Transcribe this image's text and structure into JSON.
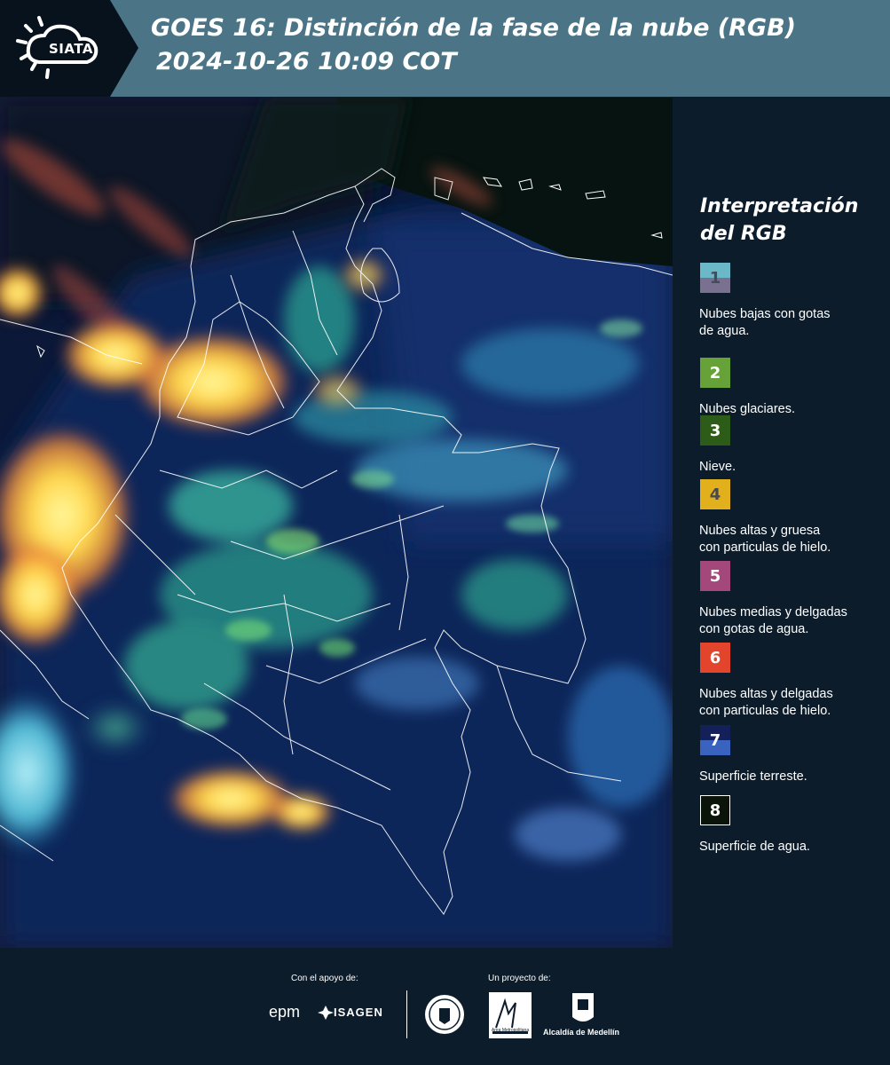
{
  "header": {
    "logo_text": "SIATA",
    "title_line1": "GOES 16: Distinción de la fase de la nube (RGB)",
    "title_line2": "2024-10-26 10:09 COT",
    "background_color": "#4b7586"
  },
  "legend": {
    "title_line1": "Interpretación",
    "title_line2": "del RGB",
    "items": [
      {
        "number": "1",
        "label_line1": "Nubes bajas con gotas",
        "label_line2": "de agua.",
        "color_top": "#6bb8c8",
        "color_bottom": "#7a7090",
        "text_color": "#454b5c"
      },
      {
        "number": "2",
        "label_line1": "Nubes glaciares.",
        "label_line2": "",
        "color_top": "#66a237",
        "color_bottom": "#66a237",
        "text_color": "#ffffff"
      },
      {
        "number": "3",
        "label_line1": "Nieve.",
        "label_line2": "",
        "color_top": "#2d5c18",
        "color_bottom": "#2d5c18",
        "text_color": "#ffffff"
      },
      {
        "number": "4",
        "label_line1": "Nubes altas y gruesa",
        "label_line2": "con particulas de hielo.",
        "color_top": "#e1b01c",
        "color_bottom": "#e1b01c",
        "text_color": "#4a4a4a"
      },
      {
        "number": "5",
        "label_line1": "Nubes medias y delgadas",
        "label_line2": "con gotas de agua.",
        "color_top": "#a4487b",
        "color_bottom": "#a4487b",
        "text_color": "#ffffff"
      },
      {
        "number": "6",
        "label_line1": "Nubes altas y delgadas",
        "label_line2": "con particulas de hielo.",
        "color_top": "#e2452b",
        "color_bottom": "#e2452b",
        "text_color": "#ffffff"
      },
      {
        "number": "7",
        "label_line1": "Superficie terreste.",
        "label_line2": "",
        "color_top": "#14205a",
        "color_bottom": "#3a63c0",
        "text_color": "#ffffff"
      },
      {
        "number": "8",
        "label_line1": "Superficie de agua.",
        "label_line2": "",
        "color_top": "#0a1408",
        "color_bottom": "#0a1408",
        "text_color": "#ffffff"
      }
    ]
  },
  "footer": {
    "support_label": "Con el apoyo de:",
    "project_label": "Un proyecto de:",
    "sponsor_epm": "epm",
    "sponsor_isagen": "ISAGEN",
    "partner_metro": "Área Metropolitana",
    "partner_medellin": "Alcaldía de Medellín"
  }
}
